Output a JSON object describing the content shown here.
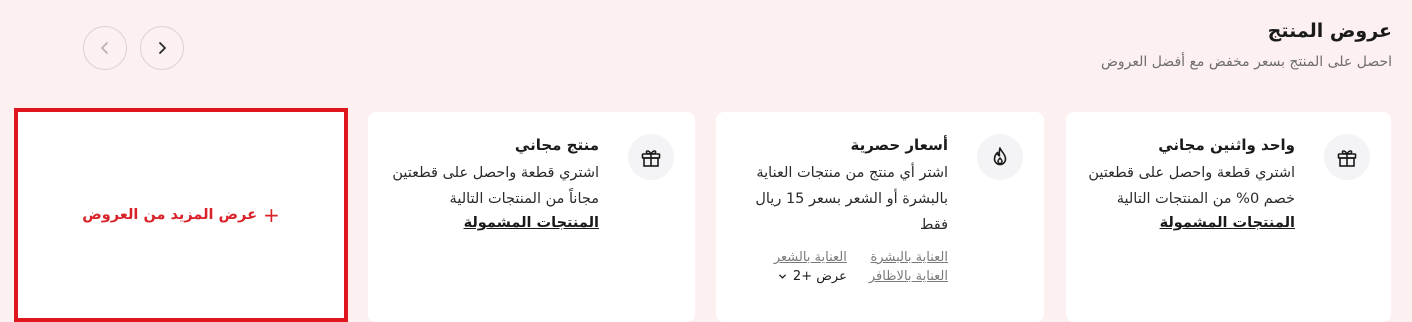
{
  "header": {
    "title": "عروض المنتج",
    "subtitle": "احصل على المنتج بسعر مخفض مع أفضل العروض"
  },
  "nav": {
    "prev_icon": "chevron-left-icon",
    "next_icon": "chevron-right-icon"
  },
  "cards": [
    {
      "icon": "gift-icon",
      "title": "واحد واثنين مجاني",
      "description": "اشتري قطعة واحصل على قطعتين خصم 0% من المنتجات التالية",
      "link": "المنتجات المشمولة"
    },
    {
      "icon": "flame-icon",
      "title": "أسعار حصرية",
      "description": "اشتر أي منتج من منتجات العناية بالبشرة أو الشعر بسعر 15 ريال فقط",
      "tags": [
        "العناية بالبشرة",
        "العناية بالشعر",
        "العناية بالاظافر"
      ],
      "more_label": "عرض +2"
    },
    {
      "icon": "gift-icon",
      "title": "منتج مجاني",
      "description": "اشتري قطعة واحصل على قطعتين مجاناً من المنتجات التالية",
      "link": "المنتجات المشمولة"
    }
  ],
  "more_offers": {
    "plus": "+",
    "label": "عرض المزيد من العروض"
  },
  "colors": {
    "background": "#fdf0f0",
    "accent": "#d9232a",
    "highlight_border": "#e0161e"
  }
}
